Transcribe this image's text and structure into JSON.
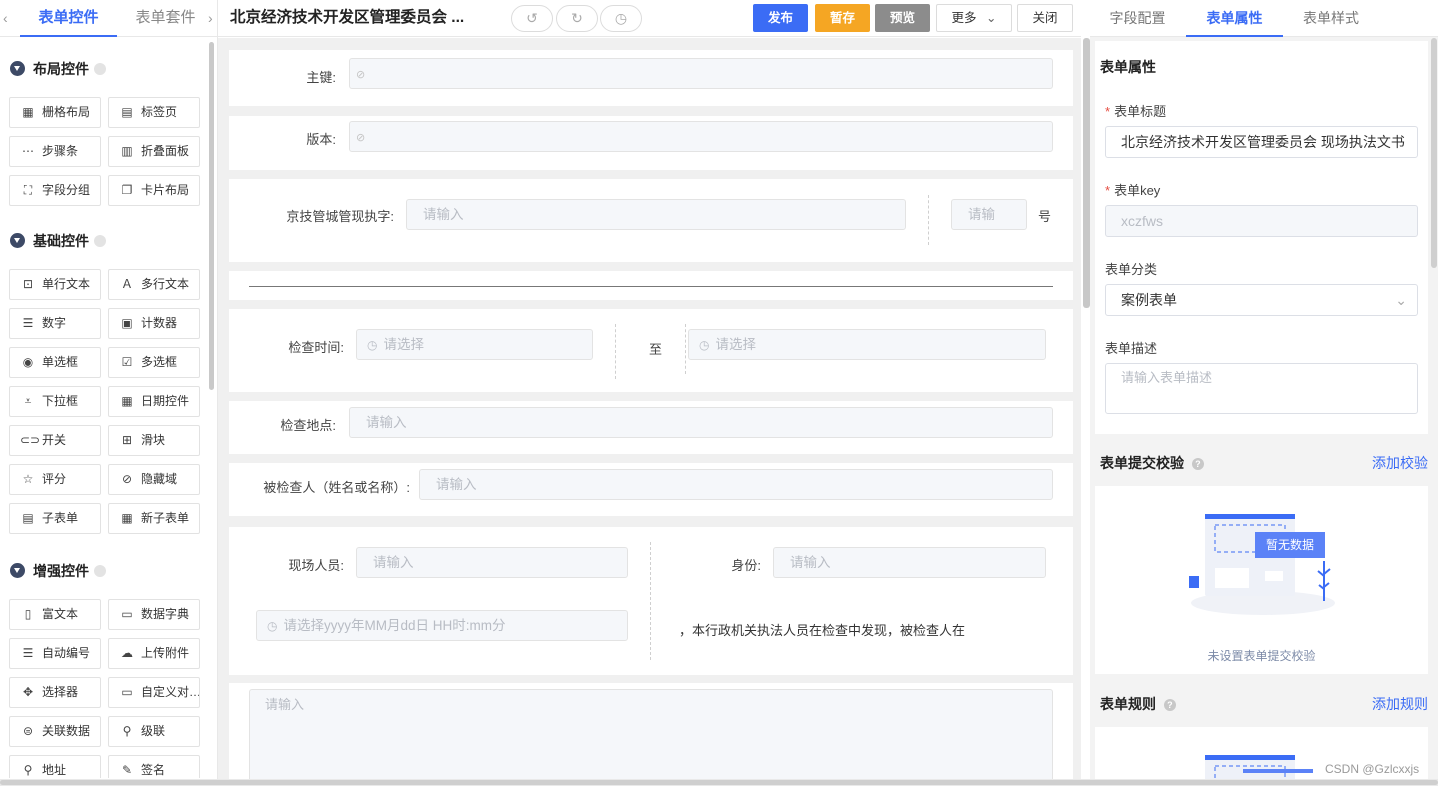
{
  "left_panel": {
    "tabs": [
      "表单控件",
      "表单套件"
    ],
    "prev_arrow": "‹",
    "next_arrow": "›",
    "groups": [
      {
        "title": "布局控件",
        "items": [
          {
            "label": "栅格布局",
            "icon": "grid-icon",
            "glyph": "▦"
          },
          {
            "label": "标签页",
            "icon": "tabs-icon",
            "glyph": "▤"
          },
          {
            "label": "步骤条",
            "icon": "steps-icon",
            "glyph": "⋯"
          },
          {
            "label": "折叠面板",
            "icon": "collapse-icon",
            "glyph": "▥"
          },
          {
            "label": "字段分组",
            "icon": "field-group-icon",
            "glyph": "⛶"
          },
          {
            "label": "卡片布局",
            "icon": "card-layout-icon",
            "glyph": "❐"
          }
        ]
      },
      {
        "title": "基础控件",
        "items": [
          {
            "label": "单行文本",
            "icon": "single-line-text-icon",
            "glyph": "⊡"
          },
          {
            "label": "多行文本",
            "icon": "multi-line-text-icon",
            "glyph": "Ａ"
          },
          {
            "label": "数字",
            "icon": "number-icon",
            "glyph": "☰"
          },
          {
            "label": "计数器",
            "icon": "counter-icon",
            "glyph": "▣"
          },
          {
            "label": "单选框",
            "icon": "radio-icon",
            "glyph": "◉"
          },
          {
            "label": "多选框",
            "icon": "checkbox-icon",
            "glyph": "☑"
          },
          {
            "label": "下拉框",
            "icon": "dropdown-icon",
            "glyph": "⩡"
          },
          {
            "label": "日期控件",
            "icon": "calendar-icon",
            "glyph": "▦"
          },
          {
            "label": "开关",
            "icon": "switch-icon",
            "glyph": "⊂⊃"
          },
          {
            "label": "滑块",
            "icon": "slider-icon",
            "glyph": "⊞"
          },
          {
            "label": "评分",
            "icon": "star-icon",
            "glyph": "☆"
          },
          {
            "label": "隐藏域",
            "icon": "hidden-field-icon",
            "glyph": "⊘"
          },
          {
            "label": "子表单",
            "icon": "subform-icon",
            "glyph": "▤"
          },
          {
            "label": "新子表单",
            "icon": "new-subform-icon",
            "glyph": "▦"
          }
        ]
      },
      {
        "title": "增强控件",
        "items": [
          {
            "label": "富文本",
            "icon": "rich-text-icon",
            "glyph": "▯"
          },
          {
            "label": "数据字典",
            "icon": "dictionary-icon",
            "glyph": "▭"
          },
          {
            "label": "自动编号",
            "icon": "auto-number-icon",
            "glyph": "☰"
          },
          {
            "label": "上传附件",
            "icon": "upload-icon",
            "glyph": "☁"
          },
          {
            "label": "选择器",
            "icon": "selector-icon",
            "glyph": "✥"
          },
          {
            "label": "自定义对…",
            "icon": "custom-dialog-icon",
            "glyph": "▭"
          },
          {
            "label": "关联数据",
            "icon": "link-data-icon",
            "glyph": "⊜"
          },
          {
            "label": "级联",
            "icon": "cascade-icon",
            "glyph": "⚲"
          },
          {
            "label": "地址",
            "icon": "location-icon",
            "glyph": "⚲"
          },
          {
            "label": "签名",
            "icon": "signature-icon",
            "glyph": "✎"
          }
        ]
      }
    ]
  },
  "header": {
    "form_title": "北京经济技术开发区管理委员会 ...",
    "undo_glyph": "↺",
    "redo_glyph": "↻",
    "history_glyph": "◷",
    "publish": "发布",
    "save_draft": "暂存",
    "preview": "预览",
    "more": "更多",
    "more_caret": "⌄",
    "close": "关闭"
  },
  "canvas": {
    "primary_key_label": "主键:",
    "version_label": "版本:",
    "hidden_eye_glyph": "⊘",
    "doc_prefix_label": "京技管城管现执字:",
    "doc_prefix_placeholder": "请输入",
    "doc_number_placeholder": "请输",
    "doc_number_suffix": "号",
    "inspect_time_label": "检查时间:",
    "time_placeholder": "请选择",
    "to_label": "至",
    "clock_glyph": "◷",
    "inspect_place_label": "检查地点:",
    "input_placeholder": "请输入",
    "inspectee_label": "被检查人（姓名或名称）:",
    "staff_label": "现场人员:",
    "identity_label": "身份:",
    "datetime_placeholder": "请选择yyyy年MM月dd日 HH时:mm分",
    "finding_text": "，本行政机关执法人员在检查中发现，被检查人在"
  },
  "right_panel": {
    "tabs": [
      "字段配置",
      "表单属性",
      "表单样式"
    ],
    "section_form_props": "表单属性",
    "form_title_label": "表单标题",
    "form_title_value": "北京经济技术开发区管理委员会 现场执法文书",
    "form_key_label": "表单key",
    "form_key_value": "xczfws",
    "form_category_label": "表单分类",
    "form_category_value": "案例表单",
    "select_caret": "⌄",
    "form_desc_label": "表单描述",
    "form_desc_placeholder": "请输入表单描述",
    "submit_validation_title": "表单提交校验",
    "add_validation": "添加校验",
    "empty_badge": "暂无数据",
    "no_validation_text": "未设置表单提交校验",
    "form_rules_title": "表单规则",
    "add_rule": "添加规则",
    "help_glyph": "?",
    "required_mark": "*"
  },
  "watermark": "CSDN @Gzlcxxjs",
  "colors": {
    "primary": "#3b6cf5",
    "warning": "#f5a623",
    "muted_button": "#8c8c8c",
    "required": "#e54d42"
  }
}
